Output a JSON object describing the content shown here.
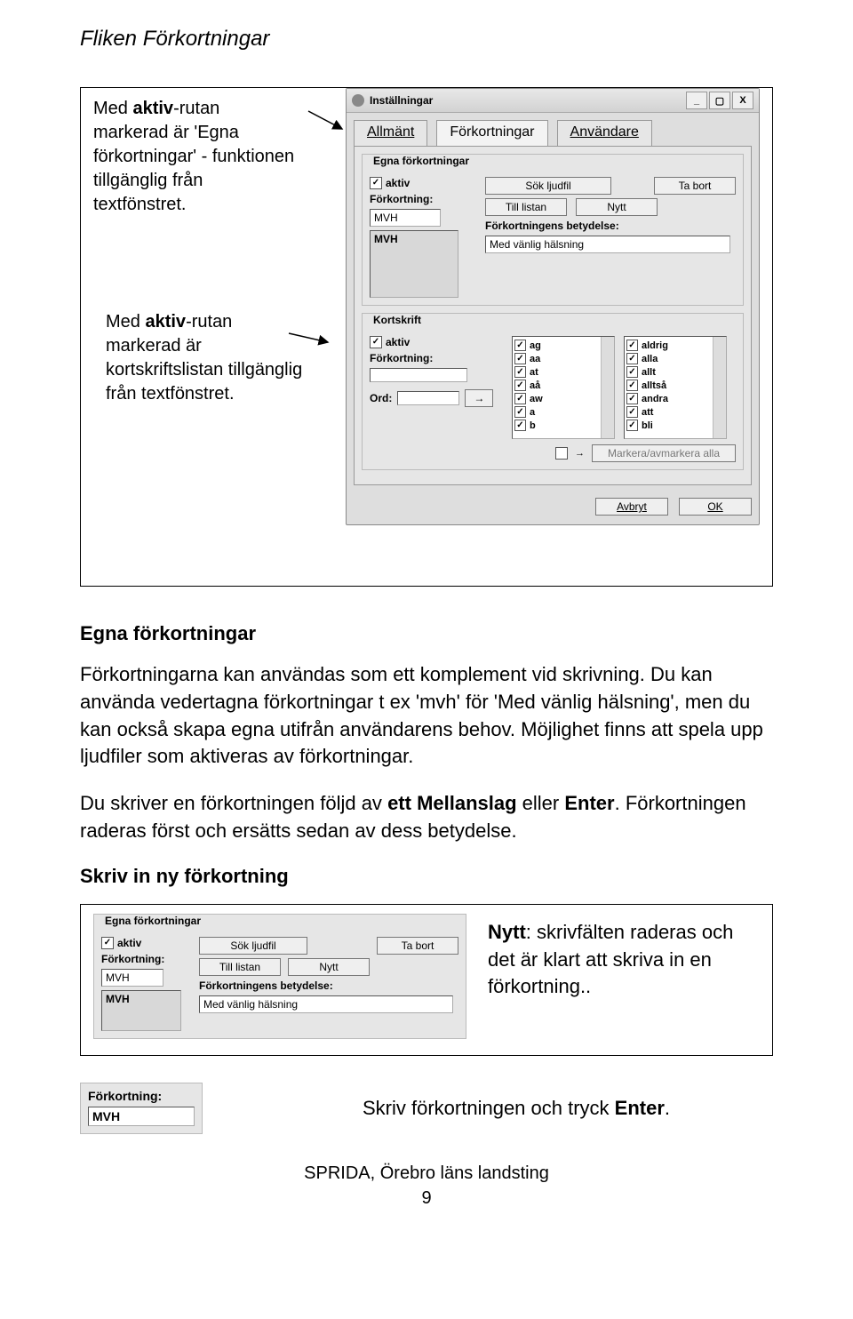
{
  "title": "Fliken Förkortningar",
  "callout1": "Med <b>aktiv</b>-rutan markerad är 'Egna förkortningar' - funktionen tillgänglig från textfönstret.",
  "callout2": "Med <b>aktiv</b>-rutan markerad är kortskriftslistan tillgänglig från textfönstret.",
  "dialog": {
    "title": "Inställningar",
    "tabs": {
      "allmant": "Allmänt",
      "forkortningar": "Förkortningar",
      "anvandare": "Användare"
    },
    "winbtns": {
      "min": "_",
      "max": "▢",
      "close": "X"
    },
    "group1": {
      "legend": "Egna förkortningar",
      "aktiv": "aktiv",
      "forkortning_lbl": "Förkortning:",
      "forkortning_val": "MVH",
      "sok_ljudfil": "Sök ljudfil",
      "till_listan": "Till listan",
      "nytt": "Nytt",
      "ta_bort": "Ta bort",
      "betydelse_lbl": "Förkortningens betydelse:",
      "betydelse_val": "Med vänlig hälsning",
      "list_item": "MVH"
    },
    "group2": {
      "legend": "Kortskrift",
      "aktiv": "aktiv",
      "forkortning_lbl": "Förkortning:",
      "ord_lbl": "Ord:",
      "listA": [
        "ag",
        "aa",
        "at",
        "aå",
        "aw",
        "a",
        "b"
      ],
      "listB": [
        "aldrig",
        "alla",
        "allt",
        "alltså",
        "andra",
        "att",
        "bli"
      ],
      "markera": "Markera/avmarkera alla"
    },
    "avbryt": "Avbryt",
    "ok": "OK"
  },
  "section_title": "Egna förkortningar",
  "para1": "Förkortningarna kan användas som ett komplement vid skrivning. Du kan använda vedertagna förkortningar t ex 'mvh' för 'Med vänlig hälsning', men du kan också skapa egna utifrån användarens behov. Möjlighet finns att spela upp ljudfiler som aktiveras av förkortningar.",
  "para2": "Du skriver en förkortningen följd av <b>ett Mellanslag</b> eller <b>Enter</b>. Förkortningen raderas först och ersätts sedan av dess betydelse.",
  "skriv_in": "Skriv in ny förkortning",
  "nytt_right": "<b>Nytt</b>: skrivfälten raderas och det är klart att skriva in en förkortning..",
  "fragment": {
    "lbl": "Förkortning:",
    "val": "MVH"
  },
  "fragment_text": "Skriv förkortningen och tryck <b>Enter</b>.",
  "footer": "SPRIDA, Örebro läns landsting",
  "pagenum": "9"
}
